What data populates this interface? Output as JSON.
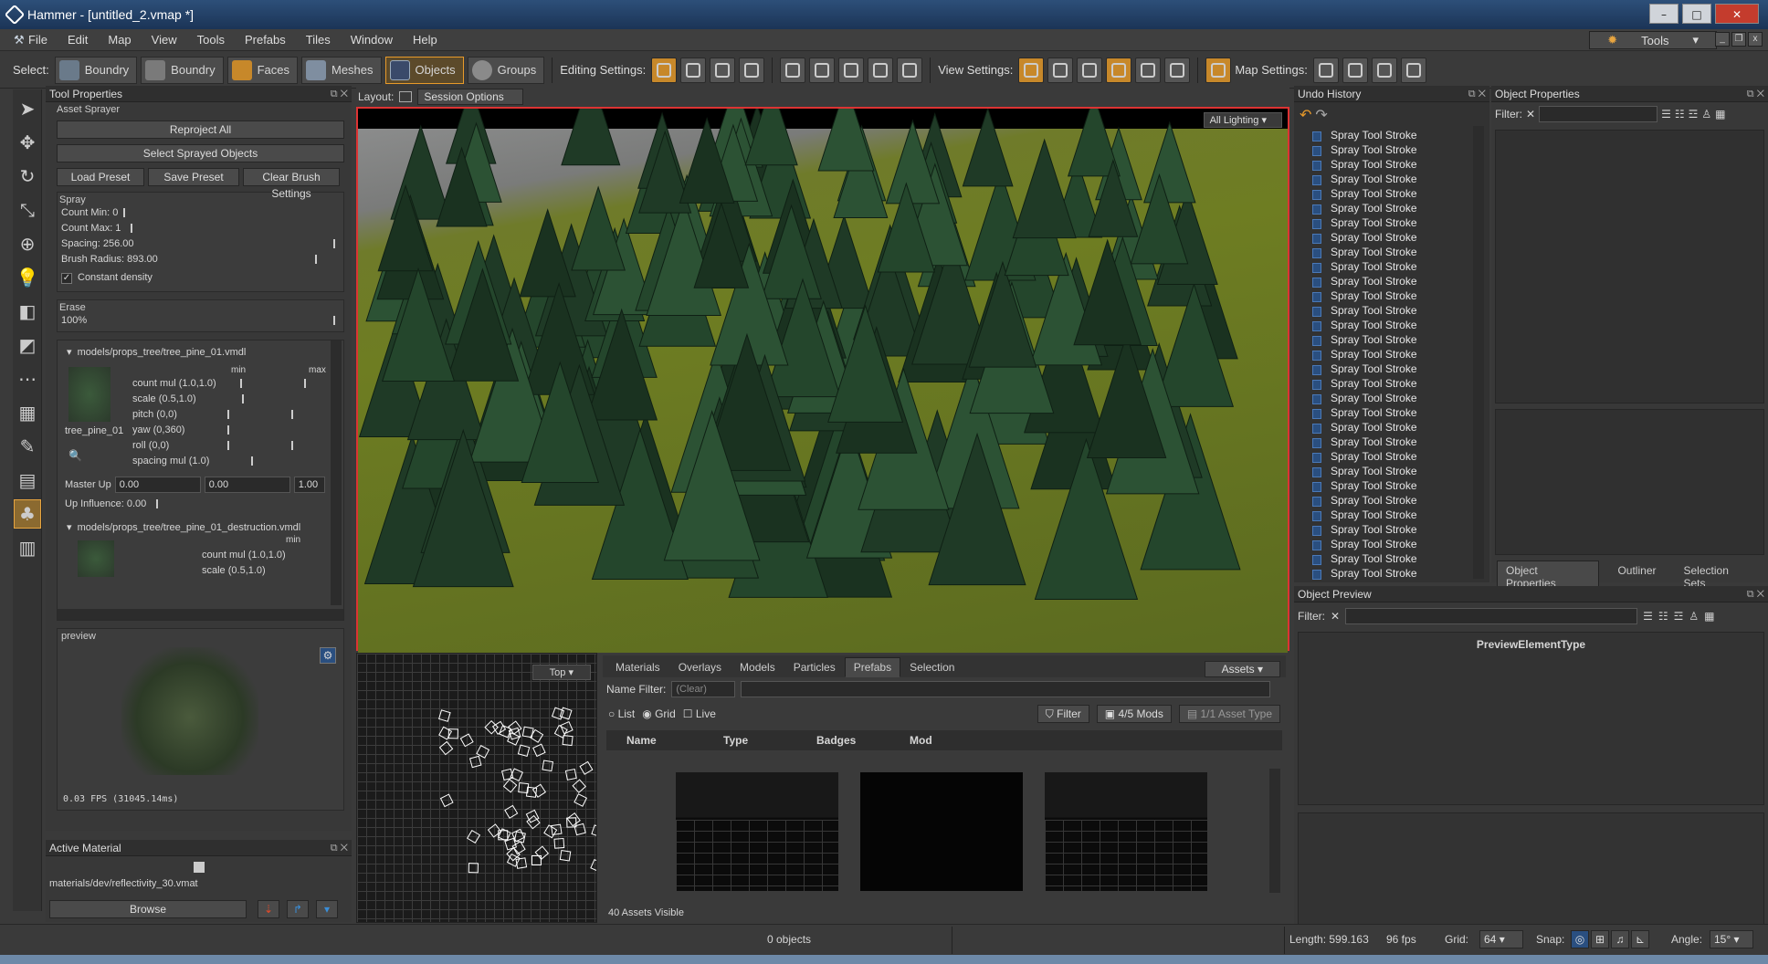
{
  "window": {
    "title": "Hammer - [untitled_2.vmap *]"
  },
  "menu": {
    "items": [
      "File",
      "Edit",
      "Map",
      "View",
      "Tools",
      "Prefabs",
      "Tiles",
      "Window",
      "Help"
    ],
    "tools_button": "Tools"
  },
  "toolbar": {
    "select_label": "Select:",
    "select_buttons": [
      "Boundry",
      "Boundry",
      "Faces",
      "Meshes",
      "Objects",
      "Groups"
    ],
    "editing_label": "Editing Settings:",
    "view_label": "View Settings:",
    "map_label": "Map Settings:"
  },
  "tool_properties": {
    "title": "Tool Properties",
    "section": "Asset Sprayer",
    "reproject": "Reproject All",
    "select_sprayed": "Select Sprayed Objects",
    "load_preset": "Load Preset",
    "save_preset": "Save Preset",
    "clear_brush": "Clear Brush Settings",
    "spray_group": "Spray",
    "count_min": "Count Min: 0",
    "count_max": "Count Max: 1",
    "spacing": "Spacing: 256.00",
    "brush_radius": "Brush Radius: 893.00",
    "constant_density": "Constant density",
    "erase_group": "Erase",
    "erase_value": "100%",
    "model1": {
      "path": "models/props_tree/tree_pine_01.vmdl",
      "thumb_label": "tree_pine_01",
      "min": "min",
      "max": "max",
      "rows": [
        "count mul (1.0,1.0)",
        "scale (0.5,1.0)",
        "pitch (0,0)",
        "yaw (0,360)",
        "roll (0,0)",
        "spacing mul (1.0)"
      ],
      "master_up_label": "Master Up",
      "master_up": [
        "0.00",
        "0.00",
        "1.00"
      ],
      "up_influence": "Up Influence: 0.00"
    },
    "model2": {
      "path": "models/props_tree/tree_pine_01_destruction.vmdl",
      "min": "min",
      "rows": [
        "count mul (1.0,1.0)",
        "scale (0.5,1.0)"
      ]
    },
    "preview_label": "preview",
    "fps": "0.03 FPS (31045.14ms)"
  },
  "active_material": {
    "title": "Active Material",
    "path": "materials/dev/reflectivity_30.vmat",
    "browse": "Browse"
  },
  "layout": {
    "label": "Layout:",
    "session": "Session Options"
  },
  "viewport": {
    "lighting": "All Lighting"
  },
  "minimap": {
    "view": "Top"
  },
  "assets": {
    "tabs": [
      "Materials",
      "Overlays",
      "Models",
      "Particles",
      "Prefabs",
      "Selection"
    ],
    "active_tab": "Prefabs",
    "assets_btn": "Assets",
    "name_filter_label": "Name Filter:",
    "name_filter_placeholder": "(Clear)",
    "list": "List",
    "grid": "Grid",
    "live": "Live",
    "filter": "Filter",
    "mods": "4/5 Mods",
    "asset_type": "1/1 Asset Type",
    "columns": [
      "Name",
      "Type",
      "Badges",
      "Mod"
    ],
    "visible": "40 Assets Visible"
  },
  "undo": {
    "title": "Undo History",
    "items": [
      "Spray Tool Stroke",
      "Spray Tool Stroke",
      "Spray Tool Stroke",
      "Spray Tool Stroke",
      "Spray Tool Stroke",
      "Spray Tool Stroke",
      "Spray Tool Stroke",
      "Spray Tool Stroke",
      "Spray Tool Stroke",
      "Spray Tool Stroke",
      "Spray Tool Stroke",
      "Spray Tool Stroke",
      "Spray Tool Stroke",
      "Spray Tool Stroke",
      "Spray Tool Stroke",
      "Spray Tool Stroke",
      "Spray Tool Stroke",
      "Spray Tool Stroke",
      "Spray Tool Stroke",
      "Spray Tool Stroke",
      "Spray Tool Stroke",
      "Spray Tool Stroke",
      "Spray Tool Stroke",
      "Spray Tool Stroke",
      "Spray Tool Stroke",
      "Spray Tool Stroke",
      "Spray Tool Stroke",
      "Spray Tool Stroke",
      "Spray Tool Stroke",
      "Spray Tool Stroke",
      "Spray Tool Stroke"
    ]
  },
  "object_properties": {
    "title": "Object Properties",
    "filter": "Filter:",
    "tabs": [
      "Object Properties",
      "Outliner",
      "Selection Sets"
    ]
  },
  "object_preview": {
    "title": "Object Preview",
    "filter": "Filter:",
    "element_type": "PreviewElementType"
  },
  "status": {
    "objects": "0 objects",
    "length": "Length: 599.163",
    "fps": "96 fps",
    "grid_label": "Grid:",
    "grid": "64",
    "snap": "Snap:",
    "angle_label": "Angle:",
    "angle": "15°"
  }
}
